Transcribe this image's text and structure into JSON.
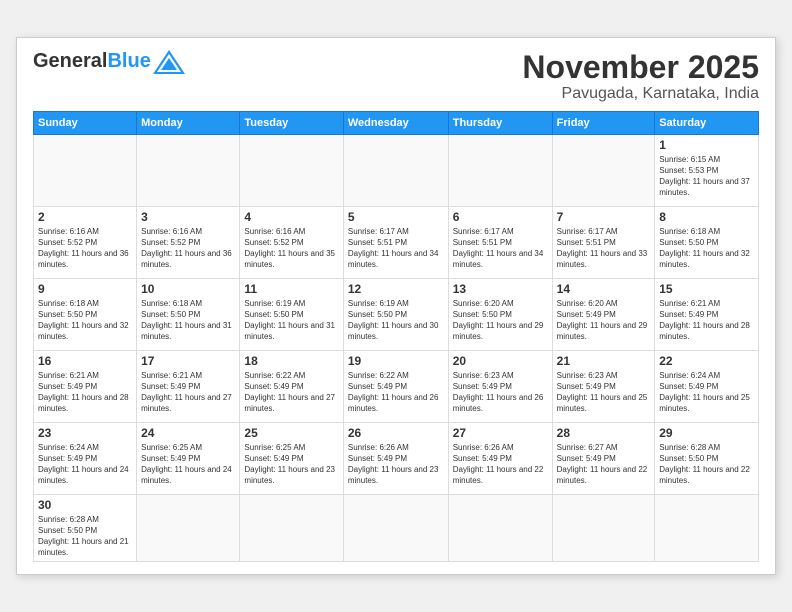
{
  "header": {
    "logo_general": "General",
    "logo_blue": "Blue",
    "month_title": "November 2025",
    "subtitle": "Pavugada, Karnataka, India"
  },
  "weekdays": [
    "Sunday",
    "Monday",
    "Tuesday",
    "Wednesday",
    "Thursday",
    "Friday",
    "Saturday"
  ],
  "days": {
    "d1": {
      "num": "1",
      "sunrise": "6:15 AM",
      "sunset": "5:53 PM",
      "daylight": "11 hours and 37 minutes."
    },
    "d2": {
      "num": "2",
      "sunrise": "6:16 AM",
      "sunset": "5:52 PM",
      "daylight": "11 hours and 36 minutes."
    },
    "d3": {
      "num": "3",
      "sunrise": "6:16 AM",
      "sunset": "5:52 PM",
      "daylight": "11 hours and 36 minutes."
    },
    "d4": {
      "num": "4",
      "sunrise": "6:16 AM",
      "sunset": "5:52 PM",
      "daylight": "11 hours and 35 minutes."
    },
    "d5": {
      "num": "5",
      "sunrise": "6:17 AM",
      "sunset": "5:51 PM",
      "daylight": "11 hours and 34 minutes."
    },
    "d6": {
      "num": "6",
      "sunrise": "6:17 AM",
      "sunset": "5:51 PM",
      "daylight": "11 hours and 34 minutes."
    },
    "d7": {
      "num": "7",
      "sunrise": "6:17 AM",
      "sunset": "5:51 PM",
      "daylight": "11 hours and 33 minutes."
    },
    "d8": {
      "num": "8",
      "sunrise": "6:18 AM",
      "sunset": "5:50 PM",
      "daylight": "11 hours and 32 minutes."
    },
    "d9": {
      "num": "9",
      "sunrise": "6:18 AM",
      "sunset": "5:50 PM",
      "daylight": "11 hours and 32 minutes."
    },
    "d10": {
      "num": "10",
      "sunrise": "6:18 AM",
      "sunset": "5:50 PM",
      "daylight": "11 hours and 31 minutes."
    },
    "d11": {
      "num": "11",
      "sunrise": "6:19 AM",
      "sunset": "5:50 PM",
      "daylight": "11 hours and 31 minutes."
    },
    "d12": {
      "num": "12",
      "sunrise": "6:19 AM",
      "sunset": "5:50 PM",
      "daylight": "11 hours and 30 minutes."
    },
    "d13": {
      "num": "13",
      "sunrise": "6:20 AM",
      "sunset": "5:50 PM",
      "daylight": "11 hours and 29 minutes."
    },
    "d14": {
      "num": "14",
      "sunrise": "6:20 AM",
      "sunset": "5:49 PM",
      "daylight": "11 hours and 29 minutes."
    },
    "d15": {
      "num": "15",
      "sunrise": "6:21 AM",
      "sunset": "5:49 PM",
      "daylight": "11 hours and 28 minutes."
    },
    "d16": {
      "num": "16",
      "sunrise": "6:21 AM",
      "sunset": "5:49 PM",
      "daylight": "11 hours and 28 minutes."
    },
    "d17": {
      "num": "17",
      "sunrise": "6:21 AM",
      "sunset": "5:49 PM",
      "daylight": "11 hours and 27 minutes."
    },
    "d18": {
      "num": "18",
      "sunrise": "6:22 AM",
      "sunset": "5:49 PM",
      "daylight": "11 hours and 27 minutes."
    },
    "d19": {
      "num": "19",
      "sunrise": "6:22 AM",
      "sunset": "5:49 PM",
      "daylight": "11 hours and 26 minutes."
    },
    "d20": {
      "num": "20",
      "sunrise": "6:23 AM",
      "sunset": "5:49 PM",
      "daylight": "11 hours and 26 minutes."
    },
    "d21": {
      "num": "21",
      "sunrise": "6:23 AM",
      "sunset": "5:49 PM",
      "daylight": "11 hours and 25 minutes."
    },
    "d22": {
      "num": "22",
      "sunrise": "6:24 AM",
      "sunset": "5:49 PM",
      "daylight": "11 hours and 25 minutes."
    },
    "d23": {
      "num": "23",
      "sunrise": "6:24 AM",
      "sunset": "5:49 PM",
      "daylight": "11 hours and 24 minutes."
    },
    "d24": {
      "num": "24",
      "sunrise": "6:25 AM",
      "sunset": "5:49 PM",
      "daylight": "11 hours and 24 minutes."
    },
    "d25": {
      "num": "25",
      "sunrise": "6:25 AM",
      "sunset": "5:49 PM",
      "daylight": "11 hours and 23 minutes."
    },
    "d26": {
      "num": "26",
      "sunrise": "6:26 AM",
      "sunset": "5:49 PM",
      "daylight": "11 hours and 23 minutes."
    },
    "d27": {
      "num": "27",
      "sunrise": "6:26 AM",
      "sunset": "5:49 PM",
      "daylight": "11 hours and 22 minutes."
    },
    "d28": {
      "num": "28",
      "sunrise": "6:27 AM",
      "sunset": "5:49 PM",
      "daylight": "11 hours and 22 minutes."
    },
    "d29": {
      "num": "29",
      "sunrise": "6:28 AM",
      "sunset": "5:50 PM",
      "daylight": "11 hours and 22 minutes."
    },
    "d30": {
      "num": "30",
      "sunrise": "6:28 AM",
      "sunset": "5:50 PM",
      "daylight": "11 hours and 21 minutes."
    }
  }
}
